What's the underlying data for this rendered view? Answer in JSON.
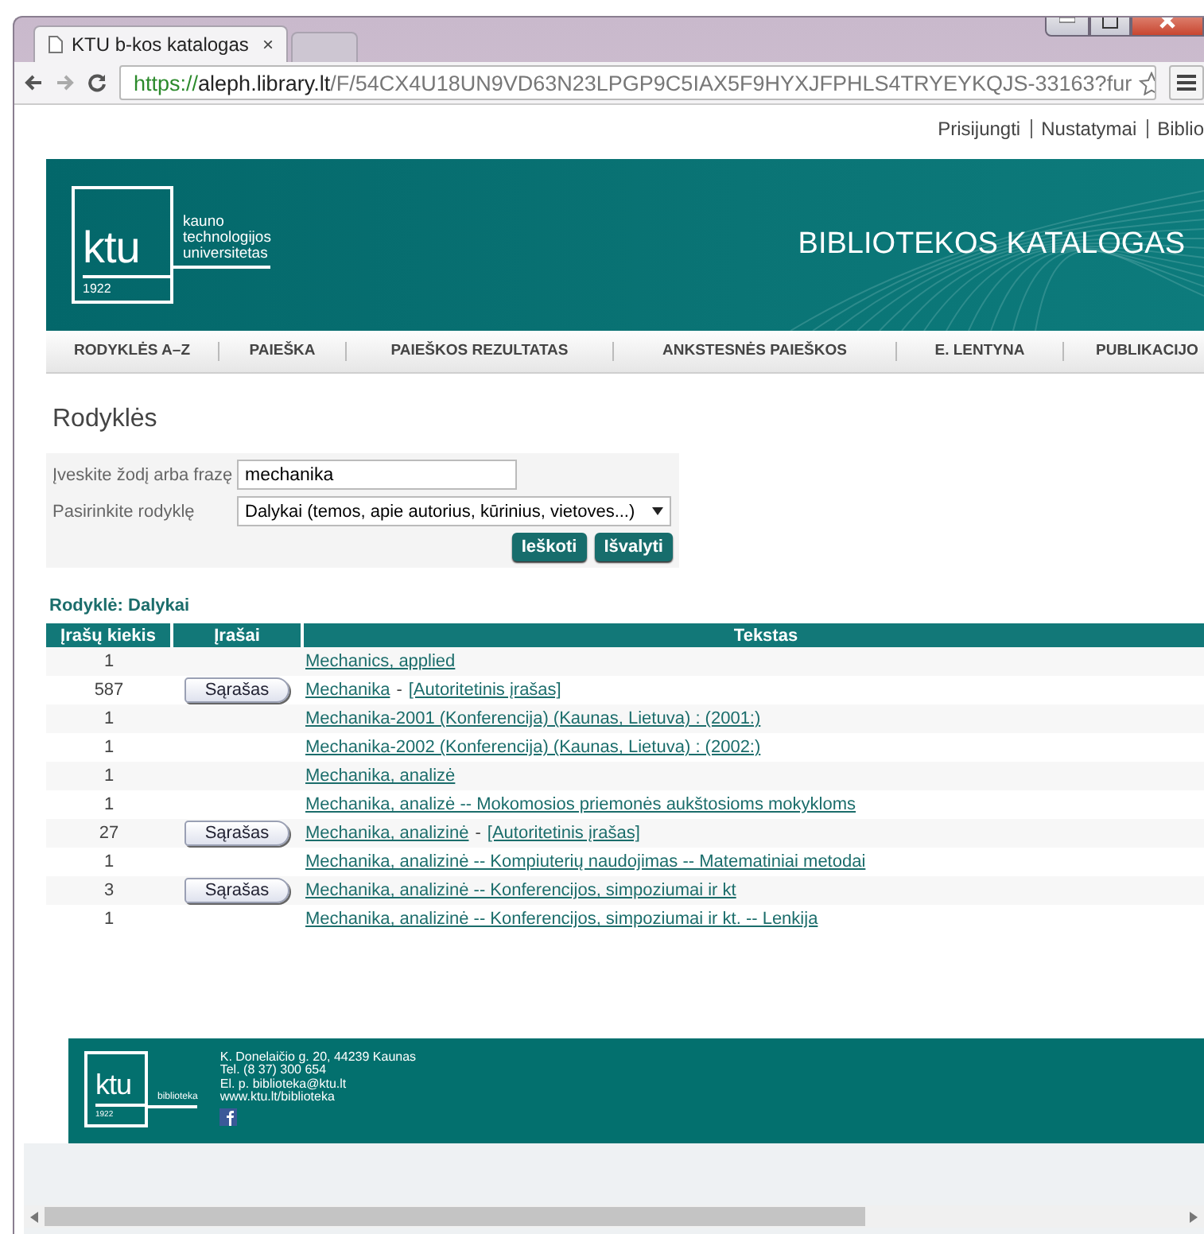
{
  "window": {
    "tabs": [
      {
        "title": "KTU b-kos katalogas",
        "close": "×",
        "selected": true
      }
    ]
  },
  "address_bar": {
    "scheme": "https://",
    "host": "aleph.library.lt",
    "path": "/F/54CX4U18UN9VD63N23LPGP9C5IAX5F9HYXJFPHLS4TRYEYKQJS-33163?fur"
  },
  "top_links": [
    "Prisijungti",
    "Nustatymai",
    "Biblio"
  ],
  "header": {
    "logo": {
      "mark": "ktu",
      "year": "1922",
      "name_lines": [
        "kauno",
        "technologijos",
        "universitetas"
      ]
    },
    "title": "BIBLIOTEKOS KATALOGAS"
  },
  "nav": [
    {
      "label": "RODYKLĖS A–Z",
      "selected": false
    },
    {
      "label": "PAIEŠKA",
      "selected": false
    },
    {
      "label": "PAIEŠKOS REZULTATAS",
      "selected": false
    },
    {
      "label": "ANKSTESNĖS PAIEŠKOS",
      "selected": false
    },
    {
      "label": "E. LENTYNA",
      "selected": false
    },
    {
      "label": "PUBLIKACIJO",
      "selected": false
    }
  ],
  "page_title": "Rodyklės",
  "form": {
    "query_label": "Įveskite žodį arba frazę",
    "query_value": "mechanika",
    "index_label": "Pasirinkite rodyklę",
    "index_value": "Dalykai (temos, apie autorius, kūrinius, vietoves...)",
    "buttons": [
      "Ieškoti",
      "Išvalyti"
    ]
  },
  "results": {
    "heading": "Rodyklė: Dalykai",
    "columns": [
      "Įrašų kiekis",
      "Įrašai",
      "Tekstas"
    ],
    "rows": [
      {
        "count": "1",
        "list_button": null,
        "parts": [
          {
            "kind": "link",
            "text": "Mechanics, applied"
          }
        ]
      },
      {
        "count": "587",
        "list_button": "Sąrašas",
        "parts": [
          {
            "kind": "link",
            "text": "Mechanika"
          },
          {
            "kind": "plain",
            "text": "-"
          },
          {
            "kind": "link",
            "text": "[Autoritetinis įrašas]"
          }
        ]
      },
      {
        "count": "1",
        "list_button": null,
        "parts": [
          {
            "kind": "link",
            "text": "Mechanika-2001 (Konferencija) (Kaunas, Lietuva) : (2001:)"
          }
        ]
      },
      {
        "count": "1",
        "list_button": null,
        "parts": [
          {
            "kind": "link",
            "text": "Mechanika-2002 (Konferencija) (Kaunas, Lietuva) : (2002:)"
          }
        ]
      },
      {
        "count": "1",
        "list_button": null,
        "parts": [
          {
            "kind": "link",
            "text": "Mechanika, analizė"
          }
        ]
      },
      {
        "count": "1",
        "list_button": null,
        "parts": [
          {
            "kind": "link",
            "text": "Mechanika, analizė -- Mokomosios priemonės aukštosioms mokykloms"
          }
        ]
      },
      {
        "count": "27",
        "list_button": "Sąrašas",
        "parts": [
          {
            "kind": "link",
            "text": "Mechanika, analizinė"
          },
          {
            "kind": "plain",
            "text": "-"
          },
          {
            "kind": "link",
            "text": "[Autoritetinis įrašas]"
          }
        ]
      },
      {
        "count": "1",
        "list_button": null,
        "parts": [
          {
            "kind": "link",
            "text": "Mechanika, analizinė -- Kompiuterių naudojimas -- Matematiniai metodai"
          }
        ]
      },
      {
        "count": "3",
        "list_button": "Sąrašas",
        "parts": [
          {
            "kind": "link",
            "text": "Mechanika, analizinė -- Konferencijos, simpoziumai ir kt"
          }
        ]
      },
      {
        "count": "1",
        "list_button": null,
        "parts": [
          {
            "kind": "link",
            "text": "Mechanika, analizinė -- Konferencijos, simpoziumai ir kt. -- Lenkija"
          }
        ]
      }
    ]
  },
  "footer": {
    "logo": {
      "mark": "ktu",
      "year": "1922",
      "name": "biblioteka"
    },
    "lines": [
      "K. Donelaičio g. 20, 44239 Kaunas",
      "Tel. (8 37) 300 654",
      "El. p. biblioteka@ktu.lt",
      "www.ktu.lt/biblioteka"
    ]
  }
}
